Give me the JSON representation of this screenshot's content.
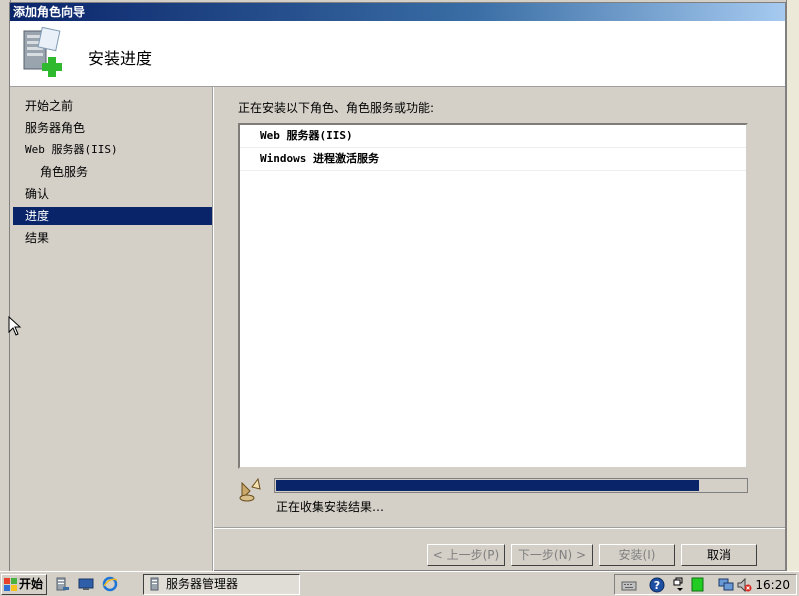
{
  "wizard": {
    "title": "添加角色向导",
    "header_title": "安装进度"
  },
  "nav": {
    "items": [
      {
        "label": "开始之前"
      },
      {
        "label": "服务器角色"
      },
      {
        "label": "Web 服务器(IIS)"
      },
      {
        "label": "角色服务"
      },
      {
        "label": "确认"
      },
      {
        "label": "进度"
      },
      {
        "label": "结果"
      }
    ]
  },
  "content": {
    "caption": "正在安装以下角色、角色服务或功能:",
    "items": [
      {
        "label": "Web 服务器(IIS)"
      },
      {
        "label": "Windows 进程激活服务"
      }
    ],
    "progress_fraction": 0.9,
    "status_text": "正在收集安装结果…"
  },
  "footer": {
    "prev_label": "< 上一步(P)",
    "next_label": "下一步(N) >",
    "install_label": "安装(I)",
    "cancel_label": "取消"
  },
  "taskbar": {
    "start_label": "开始",
    "task_label": "服务器管理器",
    "clock": "16:20"
  },
  "colors": {
    "selection": "#0a246a",
    "progress": "#0a246a",
    "title_bar_start": "#0a246a",
    "title_bar_end": "#a6caf0"
  }
}
